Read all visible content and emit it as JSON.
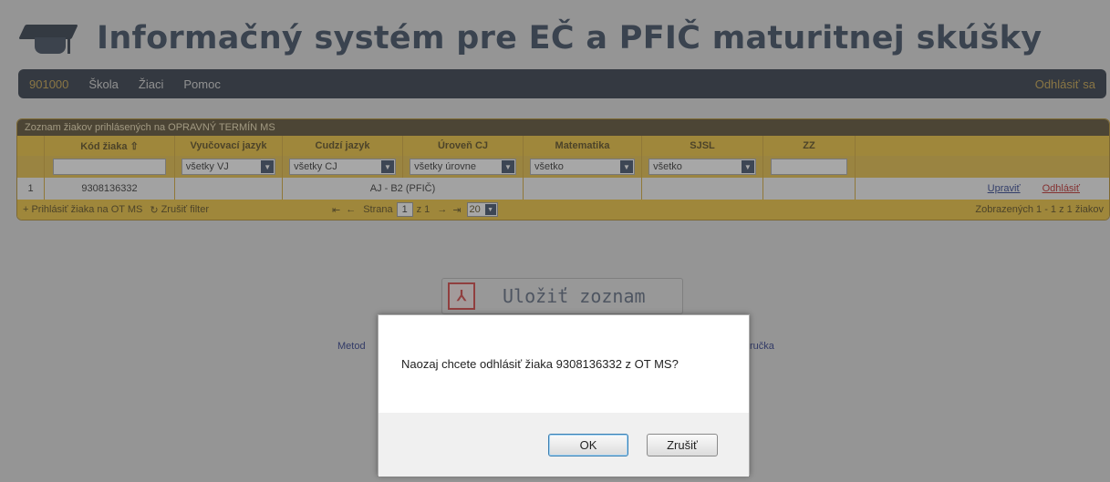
{
  "header": {
    "title": "Informačný systém pre EČ a PFIČ maturitnej skúšky"
  },
  "nav": {
    "code": "901000",
    "items": [
      "Škola",
      "Žiaci",
      "Pomoc"
    ],
    "logout": "Odhlásiť sa"
  },
  "grid": {
    "caption": "Zoznam žiakov prihlásených na OPRAVNÝ TERMÍN MS",
    "columns": [
      "Kód žiaka ⇧",
      "Vyučovací jazyk",
      "Cudzí jazyk",
      "Úroveň CJ",
      "Matematika",
      "SJSL",
      "ZZ"
    ],
    "filters": {
      "vyucovaci": "všetky VJ",
      "cudzi": "všetky CJ",
      "uroven": "všetky úrovne",
      "matematika": "všetko",
      "sjsl": "všetko"
    },
    "rows": [
      {
        "num": "1",
        "kod": "9308136332",
        "cudzi_uroven": "AJ - B2 (PFIČ)",
        "edit": "Upraviť",
        "unregister": "Odhlásiť"
      }
    ],
    "footer": {
      "add": "Prihlásiť žiaka na OT MS",
      "reset": "Zrušiť filter",
      "page_label": "Strana",
      "page": "1",
      "of": "z 1",
      "page_size": "20",
      "summary": "Zobrazených 1 - 1 z 1 žiakov"
    }
  },
  "save_list": {
    "label": "Uložiť zoznam"
  },
  "footer": {
    "left_link": "Metod",
    "right_link": "ručka"
  },
  "modal": {
    "message": "Naozaj chcete odhlásiť žiaka 9308136332 z OT MS?",
    "ok": "OK",
    "cancel": "Zrušiť"
  }
}
